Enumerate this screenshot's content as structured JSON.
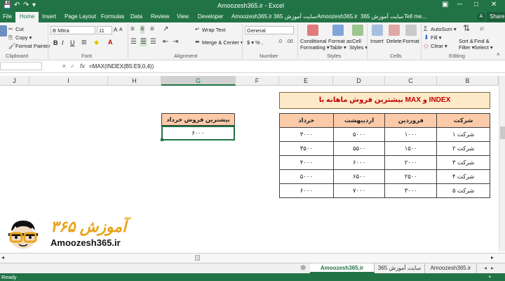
{
  "titlebar": {
    "title": "Amoozesh365.ir - Excel",
    "save_glyph": "💾",
    "undo_glyph": "↶",
    "redo_glyph": "↷",
    "more_glyph": "▾",
    "ribbon_opts_glyph": "▣",
    "minimize_glyph": "─",
    "maximize_glyph": "□",
    "close_glyph": "✕"
  },
  "tabs": [
    "File",
    "Home",
    "Insert",
    "Page Layout",
    "Formulas",
    "Data",
    "Review",
    "View",
    "Developer",
    "Amoozesh365.ir",
    "سایت آموزش 365",
    "Amoozesh365.ir",
    "سایت آموزش 365"
  ],
  "tell_me": "Tell me...",
  "user_initial": "A",
  "share_label": "Share",
  "ribbon": {
    "clipboard": {
      "cut": "Cut",
      "copy": "Copy ▾",
      "format_painter": "Format Painter",
      "label": "Clipboard"
    },
    "font": {
      "name": "B Mitra",
      "size": "11",
      "bold": "B",
      "italic": "I",
      "underline": "U",
      "grow": "A",
      "shrink": "A",
      "font_color": "A",
      "label": "Font"
    },
    "alignment": {
      "wrap": "Wrap Text",
      "merge": "Merge & Center ▾",
      "label": "Alignment"
    },
    "number": {
      "format": "General",
      "currency": "$ ▾ % ,",
      "label": "Number"
    },
    "styles": {
      "conditional": "Conditional",
      "conditional2": "Formatting ▾",
      "format_as": "Format as",
      "format_as2": "Table ▾",
      "cell": "Cell",
      "cell2": "Styles ▾",
      "label": "Styles"
    },
    "cells": {
      "insert": "Insert",
      "delete": "Delete",
      "format": "Format",
      "label": "Cells"
    },
    "editing": {
      "autosum": "AutoSum ▾",
      "fill": "Fill ▾",
      "clear": "Clear ▾",
      "sort": "Sort &",
      "sort2": "Filter ▾",
      "find": "Find &",
      "find2": "Select ▾",
      "label": "Editing"
    }
  },
  "formula_bar": {
    "fx": "fx",
    "formula": "=MAX(INDEX(B5:E9,0,4))"
  },
  "columns": [
    "J",
    "I",
    "H",
    "G",
    "F",
    "E",
    "D",
    "C",
    "B"
  ],
  "banner": "بیشترین فروش ماهانه با MAX و INDEX",
  "table": {
    "headers": [
      "خرداد",
      "اردیبهشت",
      "فروردین",
      "شرکت"
    ],
    "rows": [
      [
        "۳۰۰۰",
        "۵۰۰۰",
        "۱۰۰۰",
        "شرکت ۱"
      ],
      [
        "۳۵۰۰",
        "۵۵۰۰",
        "۱۵۰۰",
        "شرکت ۲"
      ],
      [
        "۴۰۰۰",
        "۶۰۰۰",
        "۲۰۰۰",
        "شرکت ۳"
      ],
      [
        "۵۰۰۰",
        "۶۵۰۰",
        "۲۵۰۰",
        "شرکت ۴"
      ],
      [
        "۶۰۰۰",
        "۷۰۰۰",
        "۳۰۰۰",
        "شرکت ۵"
      ]
    ]
  },
  "result": {
    "header": "بیشترین فروش خرداد",
    "value": "۶۰۰۰"
  },
  "logo": {
    "persian": "آموزش ۳۶۵",
    "english": "Amoozesh365.ir"
  },
  "sheet_tabs": [
    "Amoozesh365.ir",
    "سایت آموزش 365",
    "Amoozesh365.ir"
  ],
  "add_sheet": "⊕",
  "status": {
    "ready": "Ready",
    "zoom": "+"
  }
}
